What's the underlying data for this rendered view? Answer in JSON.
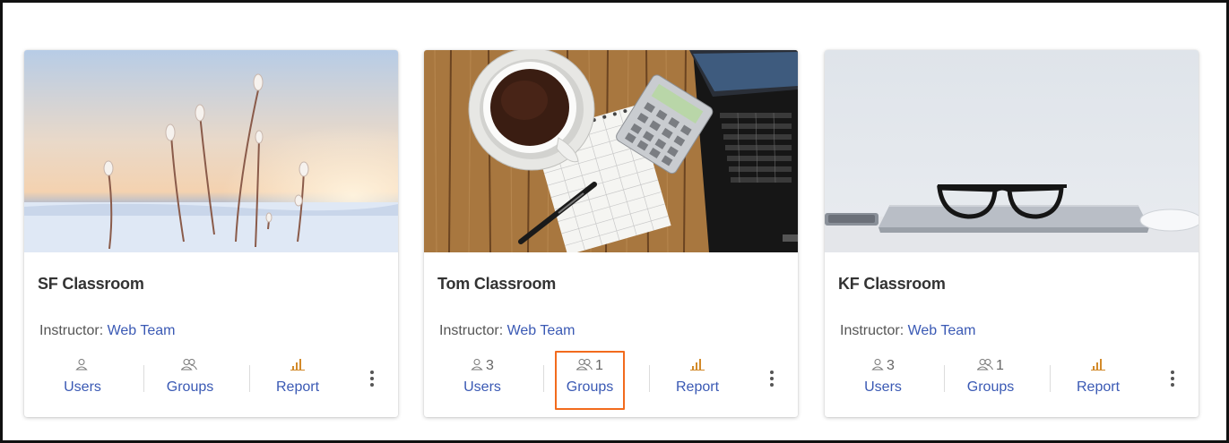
{
  "cards": [
    {
      "title": "SF Classroom",
      "instructor_label": "Instructor:",
      "instructor_name": "Web Team",
      "users_count": "",
      "users_label": "Users",
      "groups_count": "",
      "groups_label": "Groups",
      "report_label": "Report"
    },
    {
      "title": "Tom Classroom",
      "instructor_label": "Instructor:",
      "instructor_name": "Web Team",
      "users_count": "3",
      "users_label": "Users",
      "groups_count": "1",
      "groups_label": "Groups",
      "report_label": "Report"
    },
    {
      "title": "KF Classroom",
      "instructor_label": "Instructor:",
      "instructor_name": "Web Team",
      "users_count": "3",
      "users_label": "Users",
      "groups_count": "1",
      "groups_label": "Groups",
      "report_label": "Report"
    }
  ],
  "colors": {
    "link": "#3a59b4",
    "highlight": "#f26b1d"
  },
  "icons": [
    "user-icon",
    "group-icon",
    "bar-chart-icon",
    "more-vertical-icon"
  ]
}
